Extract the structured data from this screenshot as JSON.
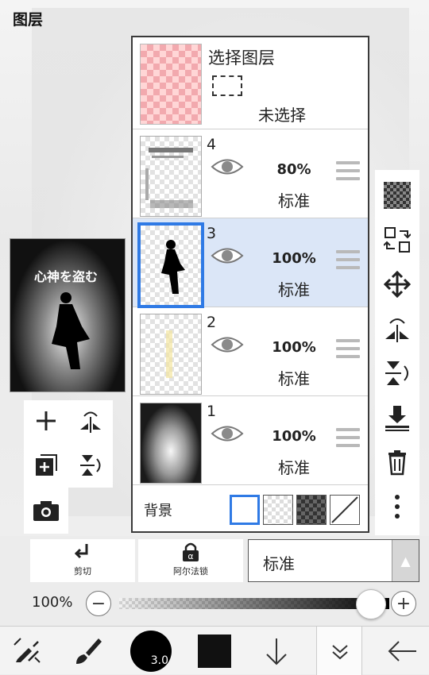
{
  "header": {
    "title": "图层"
  },
  "selection_layer": {
    "title": "选择图层",
    "status": "未选择"
  },
  "layers": [
    {
      "number": "4",
      "opacity": "80%",
      "mode": "标准"
    },
    {
      "number": "3",
      "opacity": "100%",
      "mode": "标准",
      "selected": true
    },
    {
      "number": "2",
      "opacity": "100%",
      "mode": "标准"
    },
    {
      "number": "1",
      "opacity": "100%",
      "mode": "标准"
    }
  ],
  "background": {
    "label": "背景"
  },
  "preview": {
    "text": "心神を盗む"
  },
  "blend": {
    "clip_label": "剪切",
    "alpha_lock_label": "阿尔法锁",
    "mode_value": "标准"
  },
  "opacity": {
    "value": "100%"
  },
  "brush": {
    "size": "3.0"
  },
  "colors": {
    "accent": "#2f7ae5",
    "selected_row": "#dbe6f7",
    "current_color": "#111111"
  }
}
